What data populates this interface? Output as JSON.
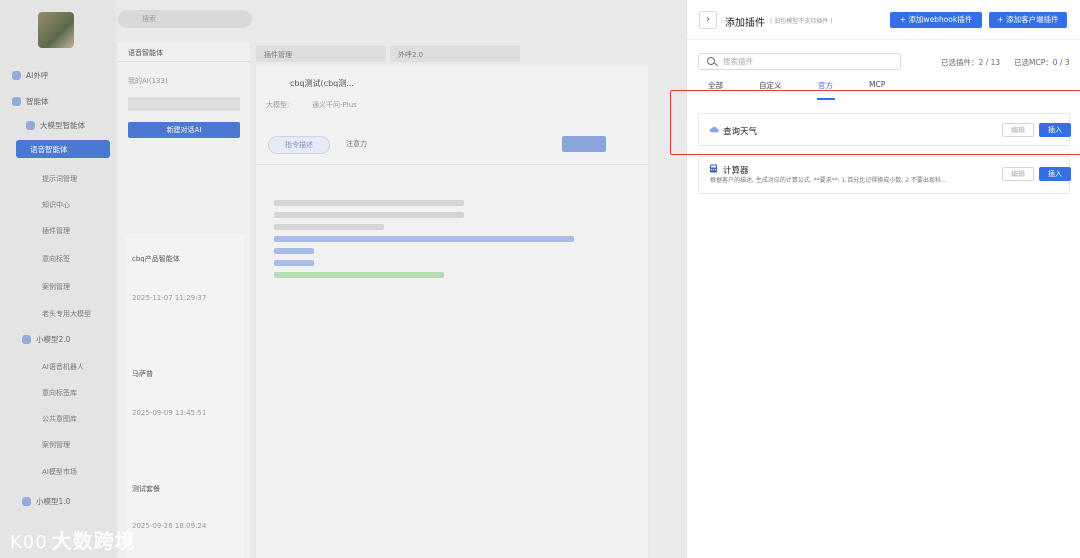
{
  "drawer": {
    "title": "添加插件",
    "subtitle": "( 旧包模型不支持插件 )",
    "collapse_icon": "›",
    "add_webhook_label": "添加webhook插件",
    "add_client_label": "添加客户端插件",
    "search_placeholder": "搜索插件",
    "selected_plugins_label": "已选插件：",
    "selected_plugins_count": "2",
    "selected_plugins_total": "/ 13",
    "selected_mcp_label": "已选MCP：",
    "selected_mcp_count": "0",
    "selected_mcp_total": "/ 3",
    "tabs": [
      {
        "label": "全部"
      },
      {
        "label": "自定义"
      },
      {
        "label": "官方"
      },
      {
        "label": "MCP"
      }
    ],
    "active_tab": "官方",
    "plugins": [
      {
        "name": "查询天气",
        "description": "",
        "edit_label": "编辑",
        "insert_label": "插入",
        "icon": "cloud-icon"
      },
      {
        "name": "计算器",
        "description": "根据客户的描述, 生成对应的计算公式. **要求**: 1.百分比记得换成小数; 2.不要出现科...",
        "edit_label": "编辑",
        "insert_label": "插入",
        "icon": "calculator-icon"
      }
    ]
  },
  "background": {
    "search_placeholder": "搜索",
    "nav_items": [
      "AI外呼",
      "智能体",
      "大模型智能体",
      "语音智能体",
      "提示词管理",
      "知识中心",
      "插件管理",
      "意向标签",
      "案例管理",
      "老头专用大模型",
      "小模型2.0",
      "AI语音机器人",
      "意向标签库",
      "公共意图库",
      "案例管理",
      "AI模型市场",
      "小模型1.0"
    ],
    "panel_title": "语音智能体",
    "my_ai_label": "我的AI(133)",
    "new_ai_button": "新建对话AI",
    "editor_title": "cbq测试(cbq测...",
    "model_label": "大模型:",
    "model_value": "通义千问-Plus",
    "prompt_tab": "指令描述",
    "attention_tab": "注意力",
    "cards": [
      {
        "title": "cbq产品智能体",
        "time": "2025-11-07 11:29:37"
      },
      {
        "title": "马萨普",
        "time": "2025-09-09 13:45:51"
      },
      {
        "title": "测试套餐",
        "time": "2025-09-26 18:09:24"
      }
    ],
    "tabs": [
      "插件管理",
      "外呼2.0"
    ]
  },
  "brand": {
    "name": "大数跨境",
    "logo_text": "K00"
  }
}
